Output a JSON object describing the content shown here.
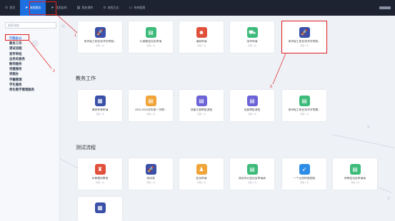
{
  "topnav": {
    "items": [
      {
        "label": "首页",
        "icon": "home-icon",
        "glyph": "⊙"
      },
      {
        "label": "流程服务",
        "icon": "send-icon",
        "glyph": "➤"
      },
      {
        "label": "我发起的",
        "icon": "send-icon",
        "glyph": "➤"
      },
      {
        "label": "我处理的",
        "icon": "document-icon",
        "glyph": "▤"
      },
      {
        "label": "流程日志",
        "icon": "clock-icon",
        "glyph": "⊙"
      },
      {
        "label": "系统管理",
        "icon": "folder-icon",
        "glyph": "▭"
      }
    ]
  },
  "sidebar": {
    "search_placeholder": "搜索流程",
    "items": [
      {
        "label": "行政办公"
      },
      {
        "label": "教务工作"
      },
      {
        "label": "测试流程"
      },
      {
        "label": "宣传审批"
      },
      {
        "label": "总务处服务"
      },
      {
        "label": "教师服务"
      },
      {
        "label": "党建服务"
      },
      {
        "label": "资服办"
      },
      {
        "label": "学籍管理"
      },
      {
        "label": "学生服务"
      },
      {
        "label": "师生教学管理服务"
      }
    ]
  },
  "sections": [
    {
      "title": "",
      "cards": [
        {
          "name": "贵州轻工职业技术学院档...",
          "meta": "流程 1 次",
          "icon": "rocket-icon",
          "color": "navy",
          "glyph": "🚀"
        },
        {
          "name": "行政楼会议室申请",
          "meta": "流程 1 次",
          "icon": "form-icon",
          "color": "green",
          "glyph": "▤"
        },
        {
          "name": "请假申请",
          "meta": "流程 1 次",
          "icon": "person-icon",
          "color": "red",
          "glyph": "☻"
        },
        {
          "name": "用车申请",
          "meta": "流程 1 次",
          "icon": "car-icon",
          "color": "green",
          "glyph": "⛟"
        },
        {
          "name": "贵州轻工职业技术学院档...",
          "meta": "流程 1 次",
          "icon": "rocket-icon",
          "color": "navy",
          "glyph": "🚀"
        }
      ]
    },
    {
      "title": "教务工作",
      "cards": [
        {
          "name": "课停补课申请",
          "meta": "流程 1 次",
          "icon": "calendar-icon",
          "color": "navy",
          "glyph": "▦"
        },
        {
          "name": "2023-2024学年第一学期...",
          "meta": "流程 1 次",
          "icon": "form-icon",
          "color": "orange",
          "glyph": "▤"
        },
        {
          "name": "技能大赛审批流程",
          "meta": "流程 1 次",
          "icon": "form-icon",
          "color": "purple",
          "glyph": "▤"
        },
        {
          "name": "竞赛审批流程",
          "meta": "流程 1 次",
          "icon": "form-icon",
          "color": "purple",
          "glyph": "▤"
        },
        {
          "name": "贵州轻工职业技术学院教...",
          "meta": "流程 1 次",
          "icon": "form-icon",
          "color": "green",
          "glyph": "▤"
        }
      ]
    },
    {
      "title": "测试流程",
      "cards": [
        {
          "name": "印章使用审批",
          "meta": "流程 1 次",
          "icon": "stamp-icon",
          "color": "red",
          "glyph": "♜"
        },
        {
          "name": "测试流",
          "meta": "流程 1 次",
          "icon": "rocket-icon",
          "color": "navy",
          "glyph": "🚀"
        },
        {
          "name": "会议申请",
          "meta": "流程 1 次",
          "icon": "podium-icon",
          "color": "orange",
          "glyph": "♟"
        },
        {
          "name": "测试办公会议室申请表",
          "meta": "流程 1 次",
          "icon": "form-icon",
          "color": "green",
          "glyph": "▤"
        },
        {
          "name": "一个无伤的流程图",
          "meta": "流程 1 次",
          "icon": "bird-icon",
          "color": "blue",
          "glyph": "➶"
        },
        {
          "name": "简单会议室申请表",
          "meta": "流程 1 次",
          "icon": "form-icon",
          "color": "green",
          "glyph": "▤"
        },
        {
          "name": "",
          "meta": "",
          "icon": "calendar-icon",
          "color": "navy",
          "glyph": "▦"
        }
      ]
    }
  ],
  "annotations": [
    "1",
    "2",
    "3"
  ],
  "colors": {
    "accent": "#1e6fe0",
    "highlight": "#e02020",
    "topbar": "#1d2330"
  }
}
